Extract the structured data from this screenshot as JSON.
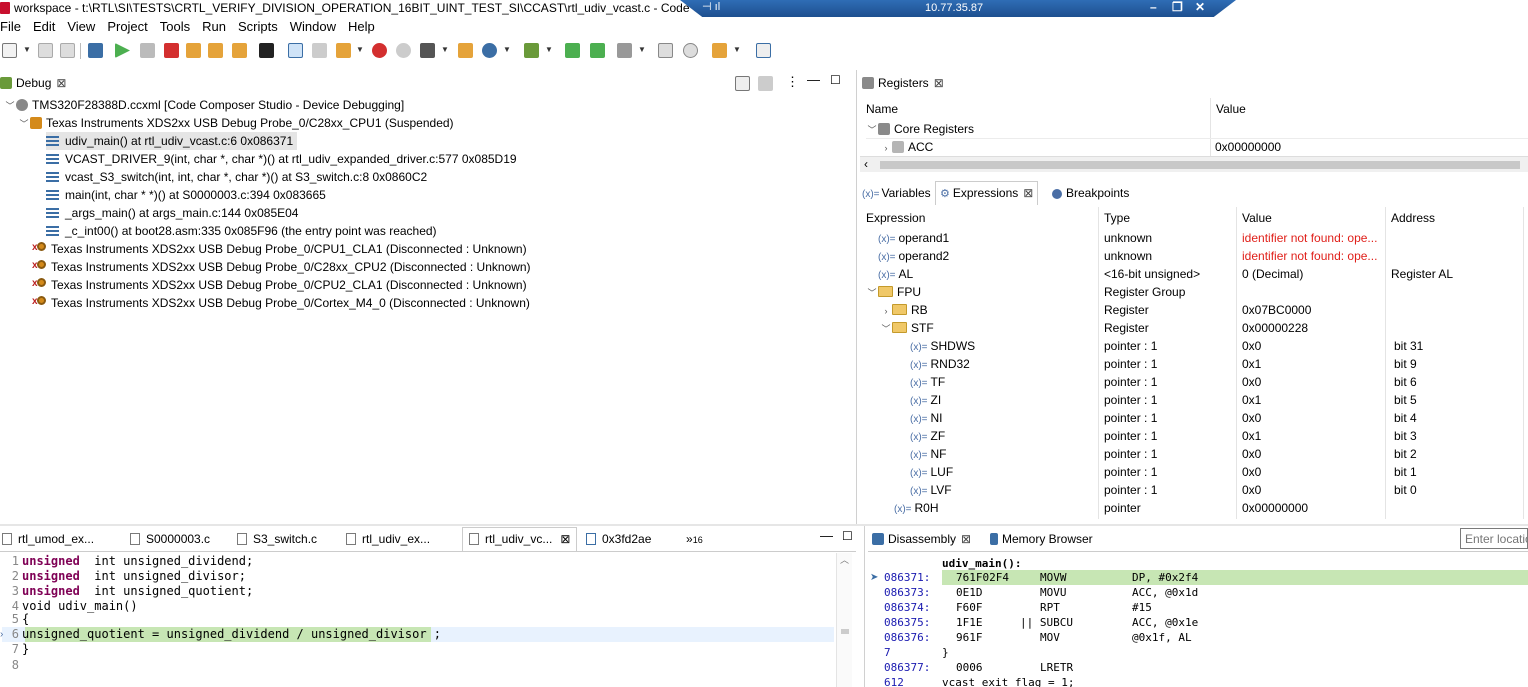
{
  "window": {
    "title": "workspace - t:\\RTL\\SI\\TESTS\\CRTL_VERIFY_DIVISION_OPERATION_16BIT_UINT_TEST_SI\\CCAST\\rtl_udiv_vcast.c - Code Composer Studio",
    "remote_ip": "10.77.35.87"
  },
  "menu": [
    "File",
    "Edit",
    "View",
    "Project",
    "Tools",
    "Run",
    "Scripts",
    "Window",
    "Help"
  ],
  "debug": {
    "tab_label": "Debug",
    "rows": [
      {
        "label": "TMS320F28388D.ccxml [Code Composer Studio - Device Debugging]"
      },
      {
        "label": "Texas Instruments XDS2xx USB Debug Probe_0/C28xx_CPU1 (Suspended)"
      },
      {
        "label": "udiv_main() at rtl_udiv_vcast.c:6 0x086371"
      },
      {
        "label": "VCAST_DRIVER_9(int, char *, char *)() at rtl_udiv_expanded_driver.c:577 0x085D19"
      },
      {
        "label": "vcast_S3_switch(int, int, char *, char *)() at S3_switch.c:8 0x0860C2"
      },
      {
        "label": "main(int, char * *)() at S0000003.c:394 0x083665"
      },
      {
        "label": "_args_main() at args_main.c:144 0x085E04"
      },
      {
        "label": "_c_int00() at boot28.asm:335 0x085F96  (the entry point was reached)"
      },
      {
        "label": "Texas Instruments XDS2xx USB Debug Probe_0/CPU1_CLA1 (Disconnected : Unknown)"
      },
      {
        "label": "Texas Instruments XDS2xx USB Debug Probe_0/C28xx_CPU2 (Disconnected : Unknown)"
      },
      {
        "label": "Texas Instruments XDS2xx USB Debug Probe_0/CPU2_CLA1 (Disconnected : Unknown)"
      },
      {
        "label": "Texas Instruments XDS2xx USB Debug Probe_0/Cortex_M4_0 (Disconnected : Unknown)"
      }
    ]
  },
  "registers": {
    "tab_label": "Registers",
    "headers": {
      "name": "Name",
      "value": "Value"
    },
    "rows": [
      {
        "name": "Core Registers",
        "value": ""
      },
      {
        "name": "ACC",
        "value": "0x00000000"
      }
    ]
  },
  "expressions": {
    "tabs": {
      "variables": "Variables",
      "expressions": "Expressions",
      "breakpoints": "Breakpoints"
    },
    "headers": {
      "expression": "Expression",
      "type": "Type",
      "value": "Value",
      "address": "Address"
    },
    "rows": [
      {
        "expr": "operand1",
        "type": "unknown",
        "value": "identifier not found: ope...",
        "address": ""
      },
      {
        "expr": "operand2",
        "type": "unknown",
        "value": "identifier not found: ope...",
        "address": ""
      },
      {
        "expr": "AL",
        "type": "<16-bit unsigned>",
        "value": "0 (Decimal)",
        "address": "Register AL"
      },
      {
        "expr": "FPU",
        "type": "Register Group",
        "value": "",
        "address": ""
      },
      {
        "expr": "RB",
        "type": "Register",
        "value": "0x07BC0000",
        "address": ""
      },
      {
        "expr": "STF",
        "type": "Register",
        "value": "0x00000228",
        "address": ""
      },
      {
        "expr": "SHDWS",
        "type": "pointer : 1",
        "value": "0x0",
        "address": "bit 31"
      },
      {
        "expr": "RND32",
        "type": "pointer : 1",
        "value": "0x1",
        "address": "bit 9"
      },
      {
        "expr": "TF",
        "type": "pointer : 1",
        "value": "0x0",
        "address": "bit 6"
      },
      {
        "expr": "ZI",
        "type": "pointer : 1",
        "value": "0x1",
        "address": "bit 5"
      },
      {
        "expr": "NI",
        "type": "pointer : 1",
        "value": "0x0",
        "address": "bit 4"
      },
      {
        "expr": "ZF",
        "type": "pointer : 1",
        "value": "0x1",
        "address": "bit 3"
      },
      {
        "expr": "NF",
        "type": "pointer : 1",
        "value": "0x0",
        "address": "bit 2"
      },
      {
        "expr": "LUF",
        "type": "pointer : 1",
        "value": "0x0",
        "address": "bit 1"
      },
      {
        "expr": "LVF",
        "type": "pointer : 1",
        "value": "0x0",
        "address": "bit 0"
      },
      {
        "expr": "R0H",
        "type": "pointer",
        "value": "0x00000000",
        "address": ""
      }
    ]
  },
  "editor": {
    "tabs": [
      {
        "label": "rtl_umod_ex..."
      },
      {
        "label": "S0000003.c"
      },
      {
        "label": "S3_switch.c"
      },
      {
        "label": "rtl_udiv_ex..."
      },
      {
        "label": "rtl_udiv_vc..."
      },
      {
        "label": "0x3fd2ae"
      }
    ],
    "overflow_count": "16",
    "lines": [
      {
        "n": "1",
        "kw": "unsigned",
        "rest": "  int unsigned_dividend;"
      },
      {
        "n": "2",
        "kw": "unsigned",
        "rest": "  int unsigned_divisor;"
      },
      {
        "n": "3",
        "kw": "unsigned",
        "rest": "  int unsigned_quotient;"
      },
      {
        "n": "4",
        "kw": "",
        "rest": "void udiv_main()"
      },
      {
        "n": "5",
        "kw": "",
        "rest": "{"
      },
      {
        "n": "6",
        "kw": "",
        "rest": "unsigned_quotient = unsigned_dividend / unsigned_divisor ;"
      },
      {
        "n": "7",
        "kw": "",
        "rest": "}"
      },
      {
        "n": "8",
        "kw": "",
        "rest": ""
      }
    ]
  },
  "disassembly": {
    "tabs": {
      "disassembly": "Disassembly",
      "memory": "Memory Browser"
    },
    "location_placeholder": "Enter location",
    "func_label": "udiv_main():",
    "lines": [
      {
        "addr": "086371:",
        "opcode": "761F02F4",
        "mnemonic": "MOVW",
        "operands": "DP, #0x2f4"
      },
      {
        "addr": "086373:",
        "opcode": "0E1D",
        "mnemonic": "MOVU",
        "operands": "ACC, @0x1d"
      },
      {
        "addr": "086374:",
        "opcode": "F60F",
        "mnemonic": "RPT",
        "operands": "#15"
      },
      {
        "addr": "086375:",
        "opcode": "1F1E",
        "mnemonic": "|| SUBCU",
        "operands": "ACC, @0x1e"
      },
      {
        "addr": "086376:",
        "opcode": "961F",
        "mnemonic": "MOV",
        "operands": "@0x1f, AL"
      }
    ],
    "src_line_num": "7",
    "src_line_text": "}",
    "line_after": {
      "addr": "086377:",
      "opcode": "0006",
      "mnemonic": "LRETR",
      "operands": ""
    },
    "tail_num": "612",
    "tail_text": "vcast exit flag = 1;"
  }
}
